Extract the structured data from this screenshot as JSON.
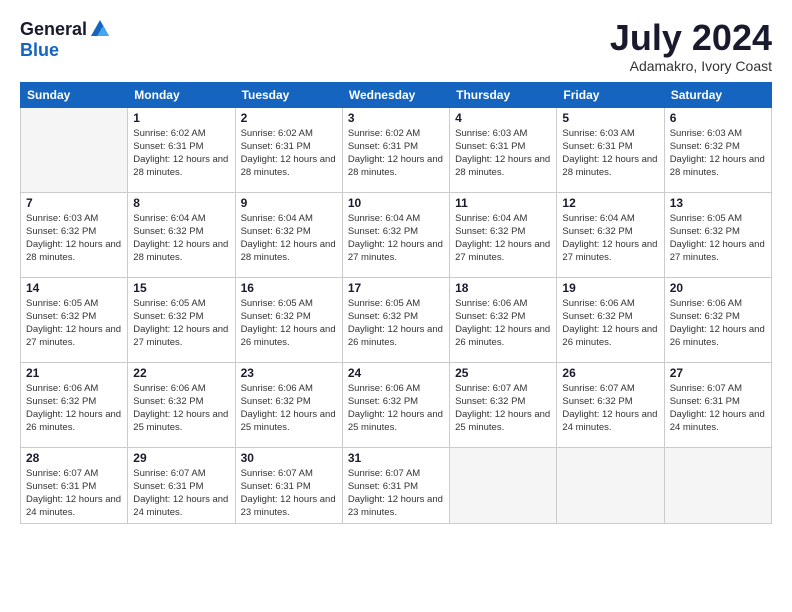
{
  "logo": {
    "general": "General",
    "blue": "Blue"
  },
  "title": "July 2024",
  "location": "Adamakro, Ivory Coast",
  "weekdays": [
    "Sunday",
    "Monday",
    "Tuesday",
    "Wednesday",
    "Thursday",
    "Friday",
    "Saturday"
  ],
  "weeks": [
    [
      {
        "day": "",
        "empty": true
      },
      {
        "day": "1",
        "sunrise": "6:02 AM",
        "sunset": "6:31 PM",
        "daylight": "12 hours and 28 minutes."
      },
      {
        "day": "2",
        "sunrise": "6:02 AM",
        "sunset": "6:31 PM",
        "daylight": "12 hours and 28 minutes."
      },
      {
        "day": "3",
        "sunrise": "6:02 AM",
        "sunset": "6:31 PM",
        "daylight": "12 hours and 28 minutes."
      },
      {
        "day": "4",
        "sunrise": "6:03 AM",
        "sunset": "6:31 PM",
        "daylight": "12 hours and 28 minutes."
      },
      {
        "day": "5",
        "sunrise": "6:03 AM",
        "sunset": "6:31 PM",
        "daylight": "12 hours and 28 minutes."
      },
      {
        "day": "6",
        "sunrise": "6:03 AM",
        "sunset": "6:32 PM",
        "daylight": "12 hours and 28 minutes."
      }
    ],
    [
      {
        "day": "7",
        "sunrise": "6:03 AM",
        "sunset": "6:32 PM",
        "daylight": "12 hours and 28 minutes."
      },
      {
        "day": "8",
        "sunrise": "6:04 AM",
        "sunset": "6:32 PM",
        "daylight": "12 hours and 28 minutes."
      },
      {
        "day": "9",
        "sunrise": "6:04 AM",
        "sunset": "6:32 PM",
        "daylight": "12 hours and 28 minutes."
      },
      {
        "day": "10",
        "sunrise": "6:04 AM",
        "sunset": "6:32 PM",
        "daylight": "12 hours and 27 minutes."
      },
      {
        "day": "11",
        "sunrise": "6:04 AM",
        "sunset": "6:32 PM",
        "daylight": "12 hours and 27 minutes."
      },
      {
        "day": "12",
        "sunrise": "6:04 AM",
        "sunset": "6:32 PM",
        "daylight": "12 hours and 27 minutes."
      },
      {
        "day": "13",
        "sunrise": "6:05 AM",
        "sunset": "6:32 PM",
        "daylight": "12 hours and 27 minutes."
      }
    ],
    [
      {
        "day": "14",
        "sunrise": "6:05 AM",
        "sunset": "6:32 PM",
        "daylight": "12 hours and 27 minutes."
      },
      {
        "day": "15",
        "sunrise": "6:05 AM",
        "sunset": "6:32 PM",
        "daylight": "12 hours and 27 minutes."
      },
      {
        "day": "16",
        "sunrise": "6:05 AM",
        "sunset": "6:32 PM",
        "daylight": "12 hours and 26 minutes."
      },
      {
        "day": "17",
        "sunrise": "6:05 AM",
        "sunset": "6:32 PM",
        "daylight": "12 hours and 26 minutes."
      },
      {
        "day": "18",
        "sunrise": "6:06 AM",
        "sunset": "6:32 PM",
        "daylight": "12 hours and 26 minutes."
      },
      {
        "day": "19",
        "sunrise": "6:06 AM",
        "sunset": "6:32 PM",
        "daylight": "12 hours and 26 minutes."
      },
      {
        "day": "20",
        "sunrise": "6:06 AM",
        "sunset": "6:32 PM",
        "daylight": "12 hours and 26 minutes."
      }
    ],
    [
      {
        "day": "21",
        "sunrise": "6:06 AM",
        "sunset": "6:32 PM",
        "daylight": "12 hours and 26 minutes."
      },
      {
        "day": "22",
        "sunrise": "6:06 AM",
        "sunset": "6:32 PM",
        "daylight": "12 hours and 25 minutes."
      },
      {
        "day": "23",
        "sunrise": "6:06 AM",
        "sunset": "6:32 PM",
        "daylight": "12 hours and 25 minutes."
      },
      {
        "day": "24",
        "sunrise": "6:06 AM",
        "sunset": "6:32 PM",
        "daylight": "12 hours and 25 minutes."
      },
      {
        "day": "25",
        "sunrise": "6:07 AM",
        "sunset": "6:32 PM",
        "daylight": "12 hours and 25 minutes."
      },
      {
        "day": "26",
        "sunrise": "6:07 AM",
        "sunset": "6:32 PM",
        "daylight": "12 hours and 24 minutes."
      },
      {
        "day": "27",
        "sunrise": "6:07 AM",
        "sunset": "6:31 PM",
        "daylight": "12 hours and 24 minutes."
      }
    ],
    [
      {
        "day": "28",
        "sunrise": "6:07 AM",
        "sunset": "6:31 PM",
        "daylight": "12 hours and 24 minutes."
      },
      {
        "day": "29",
        "sunrise": "6:07 AM",
        "sunset": "6:31 PM",
        "daylight": "12 hours and 24 minutes."
      },
      {
        "day": "30",
        "sunrise": "6:07 AM",
        "sunset": "6:31 PM",
        "daylight": "12 hours and 23 minutes."
      },
      {
        "day": "31",
        "sunrise": "6:07 AM",
        "sunset": "6:31 PM",
        "daylight": "12 hours and 23 minutes."
      },
      {
        "day": "",
        "empty": true
      },
      {
        "day": "",
        "empty": true
      },
      {
        "day": "",
        "empty": true
      }
    ]
  ]
}
